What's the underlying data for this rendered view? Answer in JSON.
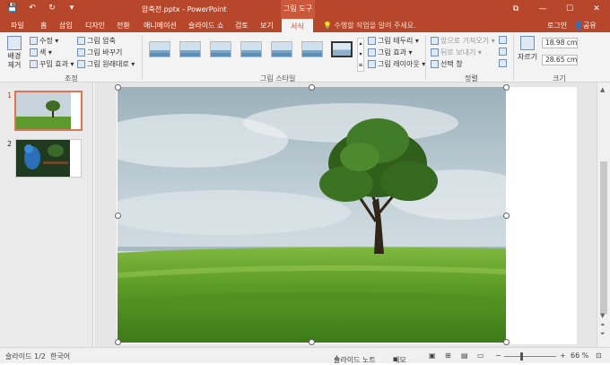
{
  "titlebar": {
    "doc_title": "압축전.pptx - PowerPoint",
    "context_label": "그림 도구",
    "qat_save": "💾",
    "qat_undo": "↶",
    "qat_redo": "↻",
    "qat_more": "▾",
    "win_restore": "⧉",
    "win_min": "—",
    "win_max": "☐",
    "win_close": "✕"
  },
  "tabs": [
    "파일",
    "홈",
    "삽입",
    "디자인",
    "전환",
    "애니메이션",
    "슬라이드 쇼",
    "검토",
    "보기",
    "서식"
  ],
  "tellme": "수행할 작업을 알려 주세요.",
  "login": "로그인",
  "share": "공유",
  "ribbon": {
    "remove_bg": "배경 제거",
    "correct": "수정 ▾",
    "color": "색 ▾",
    "art_effects": "꾸밈 효과 ▾",
    "compress": "그림 압축",
    "change": "그림 바꾸기",
    "reset": "그림 원래대로 ▾",
    "group_adjust": "조정",
    "group_styles": "그림 스타일",
    "border": "그림 테두리 ▾",
    "effects": "그림 효과 ▾",
    "layout": "그림 레이아웃 ▾",
    "bring_forward": "앞으로 가져오기 ▾",
    "send_backward": "뒤로 보내기 ▾",
    "selection_pane": "선택 창",
    "group_arrange": "정렬",
    "crop": "자르기",
    "height": "18.98 cm",
    "width": "28.65 cm",
    "group_size": "크기"
  },
  "slides": [
    {
      "num": "1"
    },
    {
      "num": "2"
    }
  ],
  "status": {
    "slide": "슬라이드 1/2",
    "lang": "한국어",
    "notes": "슬라이드 노트",
    "comments": "메모",
    "zoom": "66 %",
    "minus": "−",
    "plus": "+"
  },
  "colors": {
    "accent": "#b7472a",
    "selected_thumb": "#e27456"
  }
}
